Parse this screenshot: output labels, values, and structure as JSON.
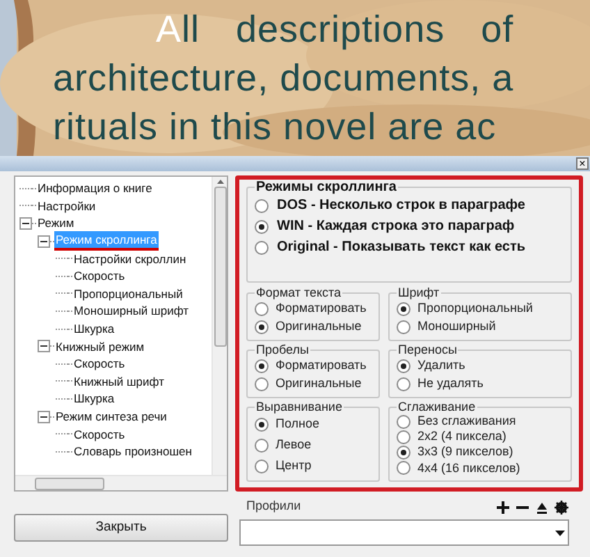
{
  "book_text": [
    "All descriptions of",
    "architecture, documents, a",
    "rituals in this novel are ac"
  ],
  "dialog": {
    "close": "×",
    "tree": [
      {
        "label": "Информация о книге",
        "selected": false
      },
      {
        "label": "Настройки",
        "selected": false
      },
      {
        "label": "Режим",
        "selected": false,
        "expanded": true,
        "children": [
          {
            "label": "Режим скроллинга",
            "selected": true,
            "expanded": true,
            "children": [
              {
                "label": "Настройки скроллин",
                "selected": false
              },
              {
                "label": "Скорость",
                "selected": false
              },
              {
                "label": "Пропорциональный",
                "selected": false
              },
              {
                "label": "Моноширный шрифт",
                "selected": false
              },
              {
                "label": "Шкурка",
                "selected": false
              }
            ]
          },
          {
            "label": "Книжный режим",
            "selected": false,
            "expanded": true,
            "children": [
              {
                "label": "Скорость",
                "selected": false
              },
              {
                "label": "Книжный шрифт",
                "selected": false
              },
              {
                "label": "Шкурка",
                "selected": false
              }
            ]
          },
          {
            "label": "Режим синтеза речи",
            "selected": false,
            "expanded": true,
            "children": [
              {
                "label": "Скорость",
                "selected": false
              },
              {
                "label": "Словарь произношен",
                "selected": false
              }
            ]
          }
        ]
      }
    ],
    "close_button": "Закрыть",
    "scroll_modes": {
      "title": "Режимы скроллинга",
      "options": [
        {
          "label": "DOS - Несколько строк в параграфе",
          "selected": false
        },
        {
          "label": "WIN - Каждая строка это параграф",
          "selected": true
        },
        {
          "label": "Original - Показывать текст как есть",
          "selected": false
        }
      ]
    },
    "groups": [
      {
        "title": "Формат текста",
        "options": [
          {
            "label": "Форматировать",
            "selected": false
          },
          {
            "label": "Оригинальные",
            "selected": true
          }
        ]
      },
      {
        "title": "Шрифт",
        "options": [
          {
            "label": "Пропорциональный",
            "selected": true
          },
          {
            "label": "Моноширный",
            "selected": false
          }
        ]
      },
      {
        "title": "Пробелы",
        "options": [
          {
            "label": "Форматировать",
            "selected": true
          },
          {
            "label": "Оригинальные",
            "selected": false
          }
        ]
      },
      {
        "title": "Переносы",
        "options": [
          {
            "label": "Удалить",
            "selected": true
          },
          {
            "label": "Не удалять",
            "selected": false
          }
        ]
      },
      {
        "title": "Выравнивание",
        "options": [
          {
            "label": "Полное",
            "selected": true
          },
          {
            "label": "Левое",
            "selected": false
          },
          {
            "label": "Центр",
            "selected": false
          }
        ]
      },
      {
        "title": "Сглаживание",
        "options": [
          {
            "label": "Без сглаживания",
            "selected": false
          },
          {
            "label": "2x2 (4 пиксела)",
            "selected": false
          },
          {
            "label": "3x3 (9 пикселов)",
            "selected": true
          },
          {
            "label": "4x4 (16 пикселов)",
            "selected": false
          }
        ]
      }
    ],
    "profiles": {
      "label": "Профили"
    }
  }
}
